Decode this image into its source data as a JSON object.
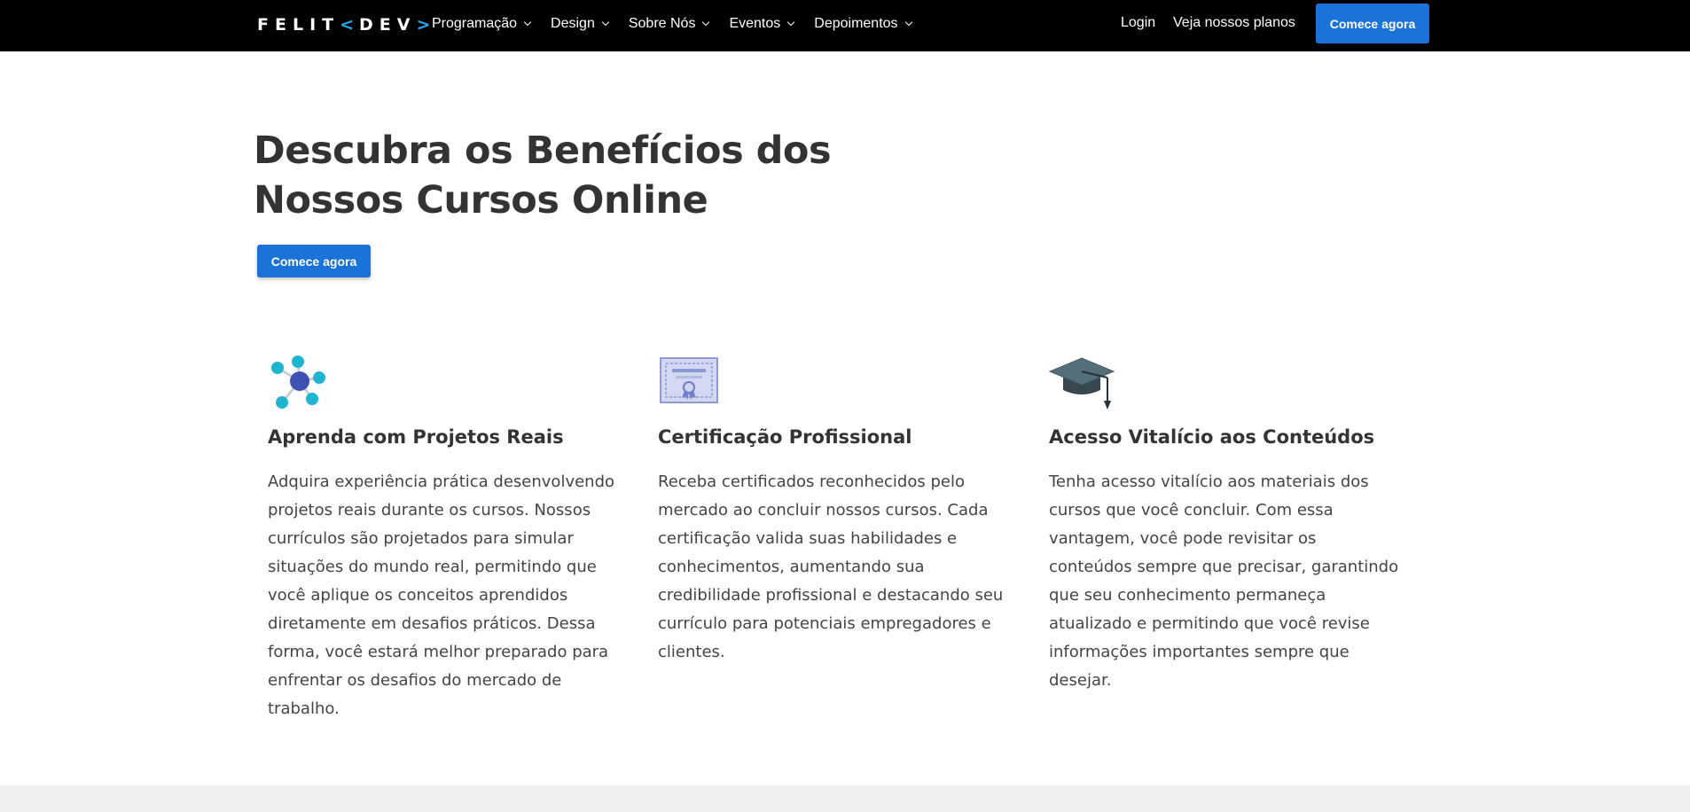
{
  "navbar": {
    "logo": {
      "left": "FELIT",
      "bracket_open": "<",
      "right": "DEV",
      "bracket_close": ">"
    },
    "menu": [
      {
        "label": "Programação"
      },
      {
        "label": "Design"
      },
      {
        "label": "Sobre Nós"
      },
      {
        "label": "Eventos"
      },
      {
        "label": "Depoimentos"
      }
    ],
    "login_label": "Login",
    "plans_label": "Veja nossos planos",
    "cta_label": "Comece agora"
  },
  "hero": {
    "title_line1": "Descubra os Benefícios dos",
    "title_line2": "Nossos Cursos Online",
    "cta_label": "Comece agora"
  },
  "features": [
    {
      "icon": "network-nodes-icon",
      "title": "Aprenda com Projetos Reais",
      "text": "Adquira experiência prática desenvolvendo projetos reais durante os cursos. Nossos currículos são projetados para simular situações do mundo real, permitindo que você aplique os conceitos aprendidos diretamente em desafios práticos. Dessa forma, você estará melhor preparado para enfrentar os desafios do mercado de trabalho."
    },
    {
      "icon": "certificate-icon",
      "title": "Certificação Profissional",
      "text": "Receba certificados reconhecidos pelo mercado ao concluir nossos cursos. Cada certificação valida suas habilidades e conhecimentos, aumentando sua credibilidade profissional e destacando seu currículo para potenciais empregadores e clientes."
    },
    {
      "icon": "graduation-cap-icon",
      "title": "Acesso Vitalício aos Conteúdos",
      "text": "Tenha acesso vitalício aos materiais dos cursos que você concluir. Com essa vantagem, você pode revisitar os conteúdos sempre que precisar, garantindo que seu conhecimento permaneça atualizado e permitindo que você revise informações importantes sempre que desejar."
    }
  ],
  "colors": {
    "navbar_bg": "#000000",
    "accent": "#1a73d9",
    "logo_bracket": "#2aa6e8",
    "text": "#333333"
  }
}
